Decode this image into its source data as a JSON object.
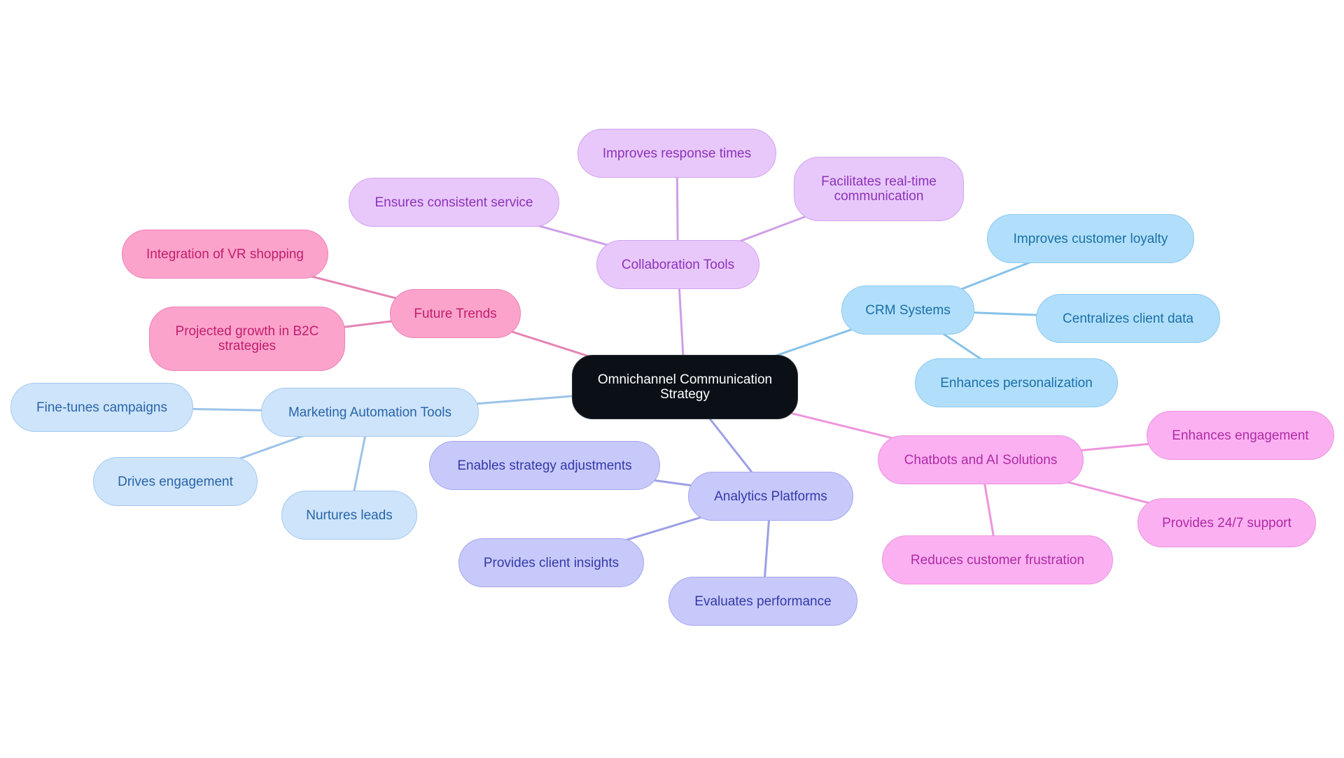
{
  "root": {
    "label": "Omnichannel Communication Strategy",
    "color": "#0b1017"
  },
  "branches": [
    {
      "key": "crm",
      "label": "CRM Systems",
      "edge_color": "#86c2e8",
      "children": [
        "Improves customer loyalty",
        "Centralizes client data",
        "Enhances personalization"
      ]
    },
    {
      "key": "chat",
      "label": "Chatbots and AI Solutions",
      "edge_color": "#ee94dc",
      "children": [
        "Enhances engagement",
        "Provides 24/7 support",
        "Reduces customer frustration"
      ]
    },
    {
      "key": "ana",
      "label": "Analytics Platforms",
      "edge_color": "#9c9fe6",
      "children": [
        "Enables strategy adjustments",
        "Provides client insights",
        "Evaluates performance"
      ]
    },
    {
      "key": "mkt",
      "label": "Marketing Automation Tools",
      "edge_color": "#9cc3ea",
      "children": [
        "Fine-tunes campaigns",
        "Drives engagement",
        "Nurtures leads"
      ]
    },
    {
      "key": "fut",
      "label": "Future Trends",
      "edge_color": "#e583b2",
      "children": [
        "Integration of VR shopping",
        "Projected growth in B2C strategies"
      ]
    },
    {
      "key": "col",
      "label": "Collaboration Tools",
      "edge_color": "#cf9ee6",
      "children": [
        "Ensures consistent service",
        "Improves response times",
        "Facilitates real-time communication"
      ]
    }
  ]
}
